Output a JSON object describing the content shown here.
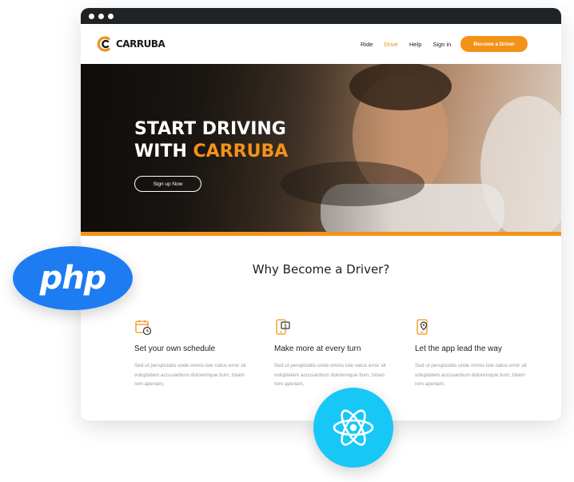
{
  "brand": {
    "name": "CARRUBA",
    "accent": "#f39218"
  },
  "nav": {
    "items": [
      "Ride",
      "Drive",
      "Help",
      "Sign in"
    ],
    "active_index": 1,
    "cta": "Become a Driver"
  },
  "hero": {
    "line1": "START DRIVING",
    "line2_prefix": "WITH ",
    "line2_accent": "CARRUBA",
    "button": "Sign up Now"
  },
  "section": {
    "title": "Why Become a Driver?"
  },
  "features": [
    {
      "icon": "calendar-clock-icon",
      "title": "Set your own schedule",
      "text": "Sed ut perspiciatis unde omnis iste natus error sit voluptatem accusantium doloremque tium, totam rem aperiam,"
    },
    {
      "icon": "phone-money-icon",
      "title": "Make more at every turn",
      "text": "Sed ut perspiciatis unde omnis iste natus error sit voluptatem accusantium doloremque tium, totam rem aperiam,"
    },
    {
      "icon": "phone-location-icon",
      "title": "Let the app lead the way",
      "text": "Sed ut perspiciatis unde omnis iste natus error sit voluptatem accusantium doloremque tium, totam rem aperiam,"
    }
  ],
  "badges": {
    "php": "php"
  }
}
